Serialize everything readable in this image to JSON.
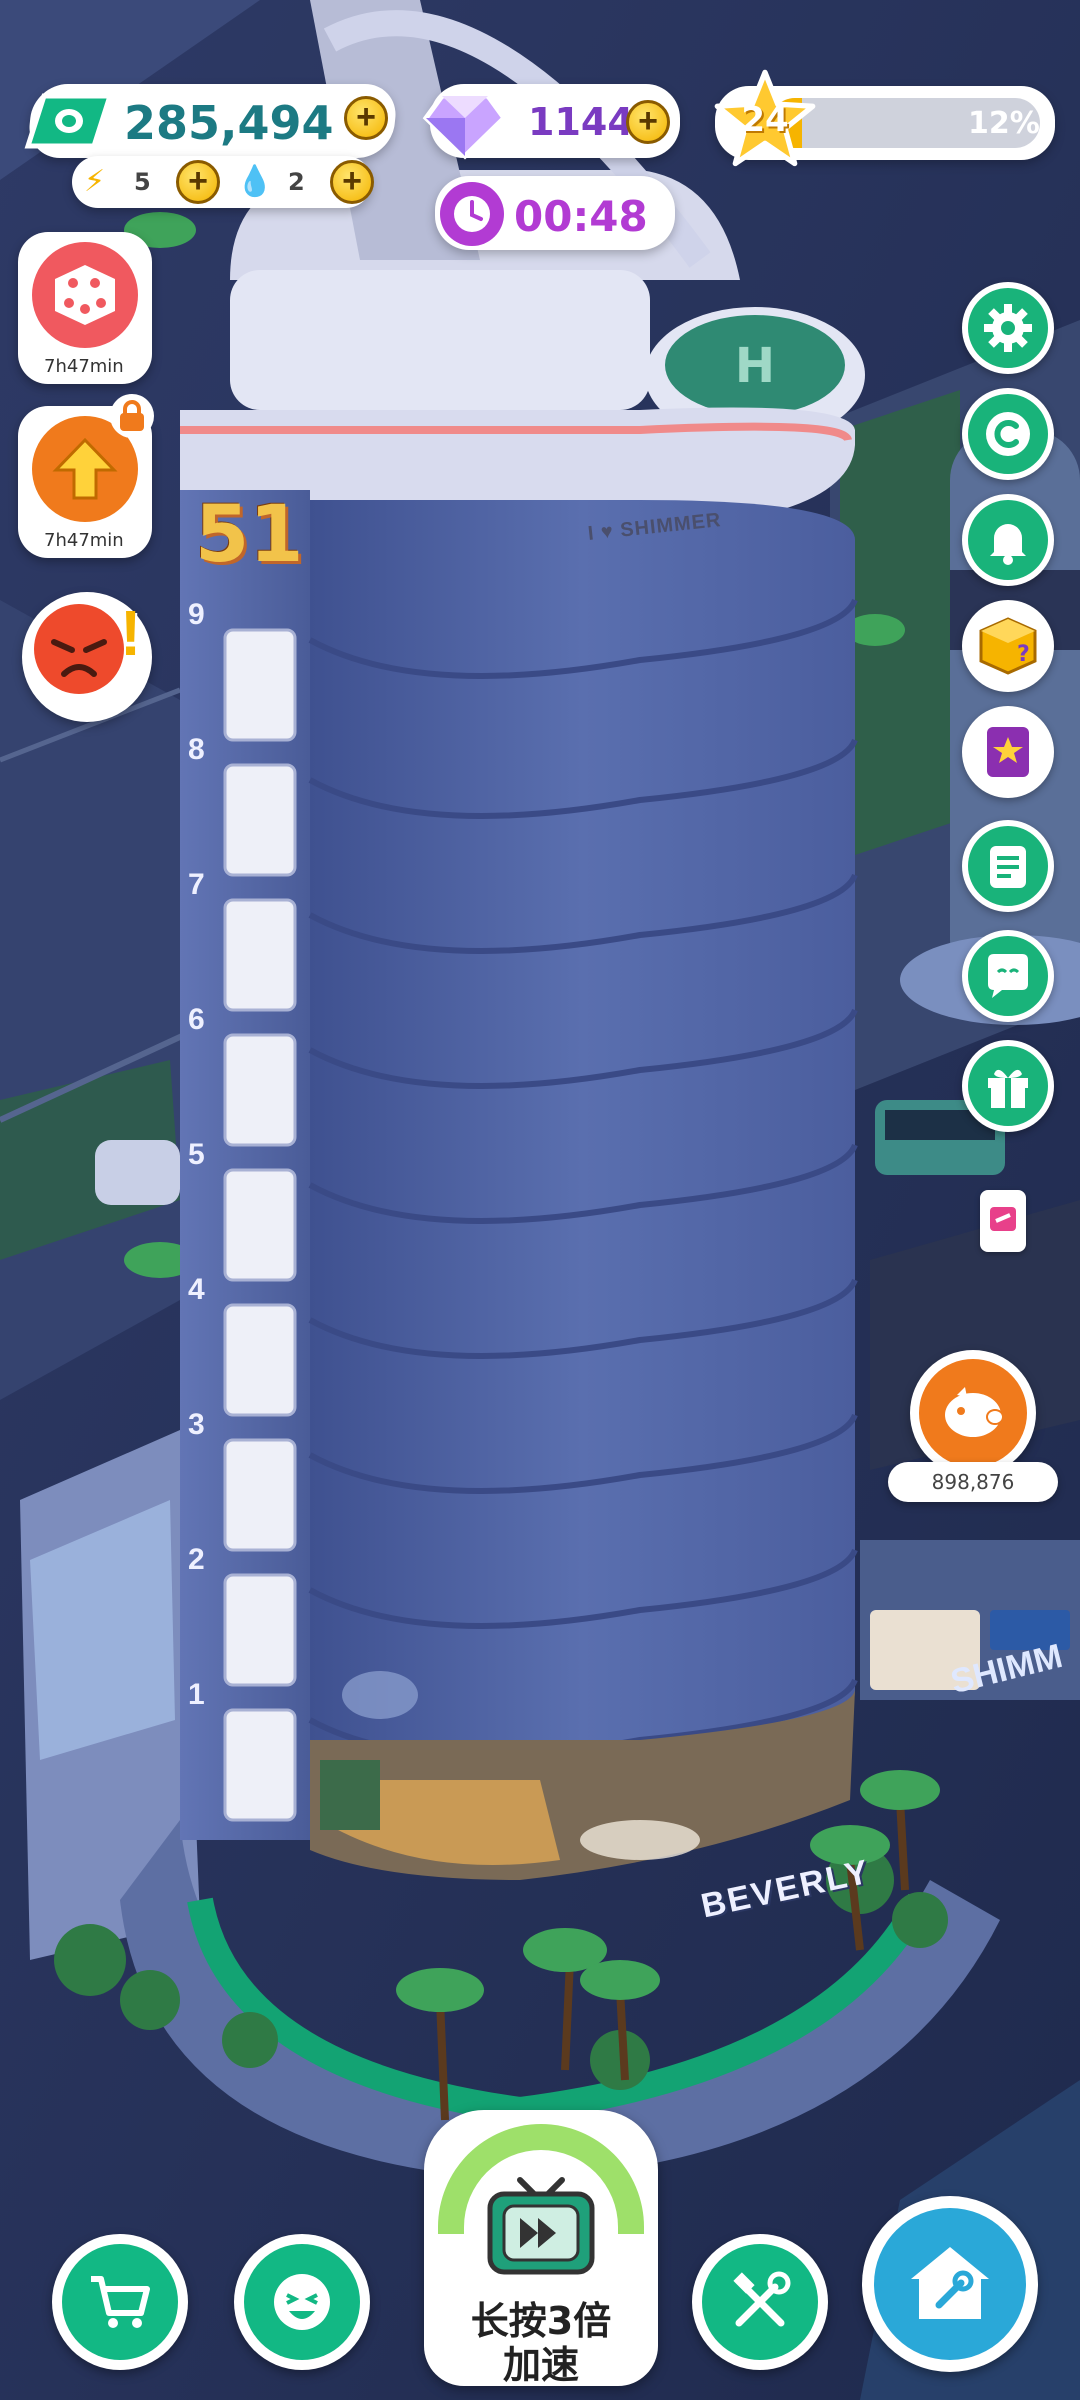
{
  "hud": {
    "cash": {
      "value": "285,494",
      "icon": "cash-icon"
    },
    "energy": {
      "value": "5",
      "icon": "lightning-icon"
    },
    "water": {
      "value": "2",
      "icon": "water-drop-icon"
    },
    "gems": {
      "value": "1144",
      "icon": "gem-icon"
    },
    "level": {
      "value": "24",
      "progress_label": "12%",
      "progress": 0.12
    },
    "timer": {
      "value": "00:48",
      "icon": "clock-icon"
    }
  },
  "left_buttons": {
    "dice": {
      "timer": "7h47min",
      "icon": "dice-icon"
    },
    "upgrade": {
      "timer": "7h47min",
      "icon": "up-arrow-icon"
    },
    "angry": {
      "icon": "angry-face-icon"
    }
  },
  "right_buttons": [
    "settings-gear-icon",
    "coupon-c-icon",
    "bell-icon",
    "mystery-box-icon",
    "star-book-icon",
    "notes-icon",
    "chat-icon",
    "gift-icon"
  ],
  "piggy_bank": {
    "value": "898,876"
  },
  "building": {
    "sign": "I ♥ SHIMMER",
    "floor_badge": "51",
    "floors": [
      "9",
      "8",
      "7",
      "6",
      "5",
      "4",
      "3",
      "2",
      "1"
    ],
    "lobby_sign": "BEVERLY",
    "billboard": "SHIMM"
  },
  "bottom_bar": {
    "speed_button_label": "长按3倍\n加速",
    "speed_line1": "长按3倍",
    "speed_line2": "加速"
  },
  "colors": {
    "accent": "#12b884",
    "tower": "#4a5f9c",
    "gold": "#f4b400",
    "purple": "#b23bd3"
  }
}
